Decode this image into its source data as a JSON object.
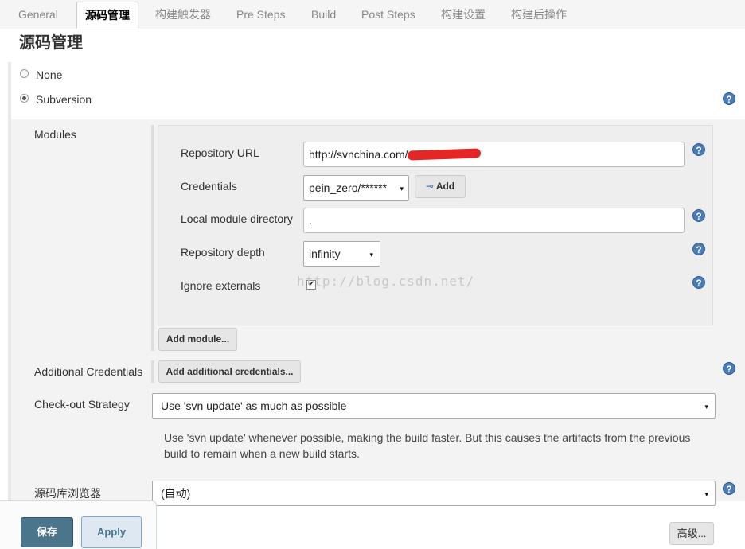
{
  "tabs": [
    "General",
    "源码管理",
    "构建触发器",
    "Pre Steps",
    "Build",
    "Post Steps",
    "构建设置",
    "构建后操作"
  ],
  "section_title": "源码管理",
  "scm_options": [
    {
      "label": "None",
      "selected": false
    },
    {
      "label": "Subversion",
      "selected": true
    }
  ],
  "modules_label": "Modules",
  "module": {
    "repository_url_label": "Repository URL",
    "repository_url_value": "http://svnchina.com/",
    "credentials_label": "Credentials",
    "credentials_value": "pein_zero/******",
    "add_button": "Add",
    "local_module_label": "Local module directory",
    "local_module_value": ".",
    "repository_depth_label": "Repository depth",
    "repository_depth_value": "infinity",
    "ignore_externals_label": "Ignore externals",
    "ignore_externals_checked": true
  },
  "watermark": "http://blog.csdn.net/",
  "add_module_button": "Add module...",
  "additional_credentials_label": "Additional Credentials",
  "add_additional_credentials_button": "Add additional credentials...",
  "checkout_strategy_label": "Check-out Strategy",
  "checkout_strategy_value": "Use 'svn update' as much as possible",
  "checkout_strategy_description": "Use 'svn update' whenever possible, making the build faster. But this causes the artifacts from the previous build to remain when a new build starts.",
  "repo_browser_label": "源码库浏览器",
  "repo_browser_value": "(自动)",
  "advanced_button": "高级...",
  "save_button": "保存",
  "apply_button": "Apply",
  "help_glyph": "?",
  "select_arrow_glyph": "▾",
  "checkbox_glyph": "✔",
  "key_glyph": "⊸",
  "colors": {
    "save_button_bg": "#4b758b",
    "help_icon": "#4a7bb5",
    "redaction": "#e32626"
  },
  "icons": [
    "help-icon",
    "key-icon",
    "dropdown-arrow-icon",
    "checkmark-icon"
  ]
}
